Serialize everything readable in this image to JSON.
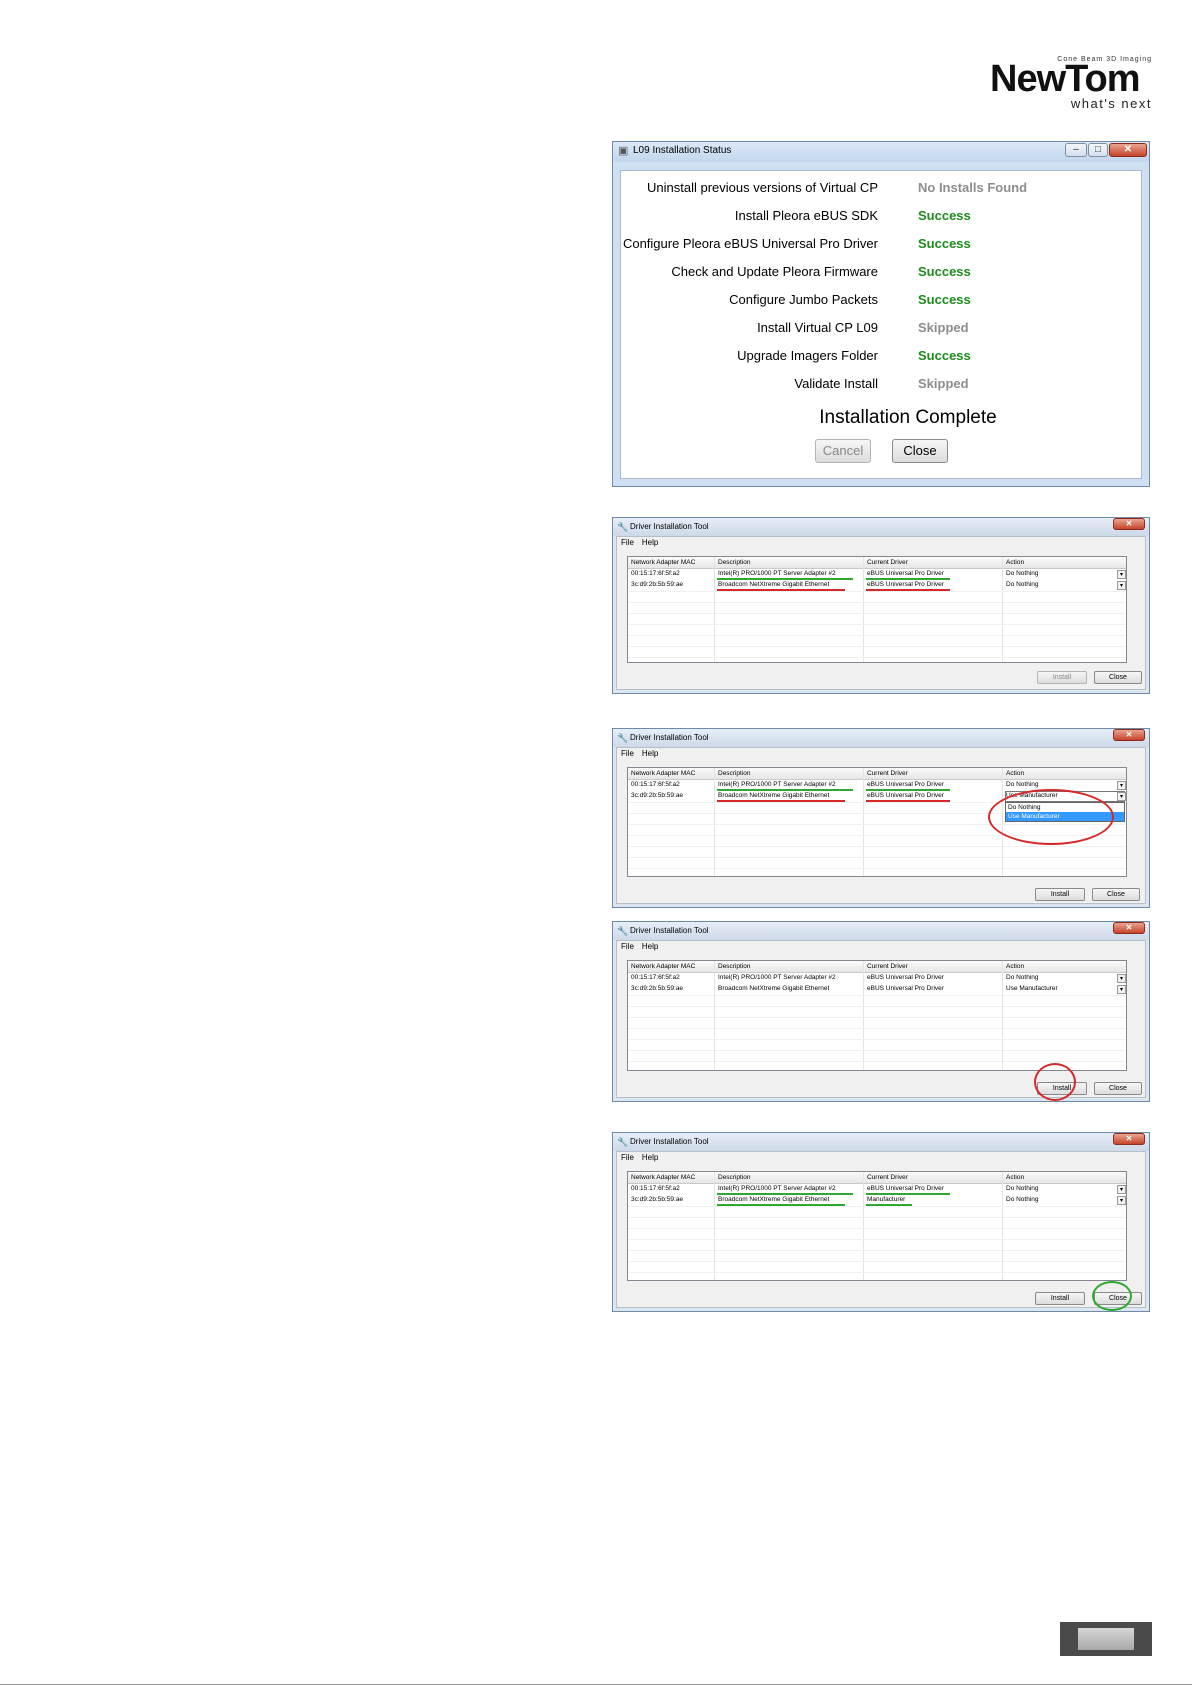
{
  "logo": {
    "tagline_top": "Cone Beam 3D Imaging",
    "brand": "NewTom",
    "tagline_bottom": "what's next"
  },
  "status_window": {
    "title": "L09 Installation Status",
    "steps": [
      {
        "name": "Uninstall previous versions of Virtual CP",
        "status": "No Installs Found",
        "kind": "muted"
      },
      {
        "name": "Install Pleora eBUS SDK",
        "status": "Success",
        "kind": "success"
      },
      {
        "name": "Configure Pleora eBUS Universal Pro Driver",
        "status": "Success",
        "kind": "success"
      },
      {
        "name": "Check and Update Pleora Firmware",
        "status": "Success",
        "kind": "success"
      },
      {
        "name": "Configure Jumbo Packets",
        "status": "Success",
        "kind": "success"
      },
      {
        "name": "Install Virtual CP L09",
        "status": "Skipped",
        "kind": "muted"
      },
      {
        "name": "Upgrade Imagers Folder",
        "status": "Success",
        "kind": "success"
      },
      {
        "name": "Validate Install",
        "status": "Skipped",
        "kind": "muted"
      }
    ],
    "complete_text": "Installation Complete",
    "cancel_label": "Cancel",
    "close_label": "Close"
  },
  "driver_tool": {
    "title": "Driver Installation Tool",
    "menu": [
      "File",
      "Help"
    ],
    "columns": [
      "Network Adapter MAC",
      "Description",
      "Current Driver",
      "Action"
    ],
    "install_label": "Install",
    "close_label": "Close",
    "dropdown_options": [
      "Do Nothing",
      "Use Manufacturer"
    ]
  },
  "screens": [
    {
      "rows": [
        {
          "mac": "00:15:17:6f:5f:a2",
          "desc": "Intel(R) PRO/1000 PT Server Adapter #2",
          "driver": "eBUS Universal Pro Driver",
          "action": "Do Nothing"
        },
        {
          "mac": "3c:d9:2b:5b:59:ae",
          "desc": "Broadcom NetXtreme Gigabit Ethernet",
          "driver": "eBUS Universal Pro Driver",
          "action": "Do Nothing"
        }
      ]
    },
    {
      "rows": [
        {
          "mac": "00:15:17:6f:5f:a2",
          "desc": "Intel(R) PRO/1000 PT Server Adapter #2",
          "driver": "eBUS Universal Pro Driver",
          "action": "Do Nothing"
        },
        {
          "mac": "3c:d9:2b:5b:59:ae",
          "desc": "Broadcom NetXtreme Gigabit Ethernet",
          "driver": "eBUS Universal Pro Driver",
          "action": "Use Manufacturer"
        }
      ]
    },
    {
      "rows": [
        {
          "mac": "00:15:17:6f:5f:a2",
          "desc": "Intel(R) PRO/1000 PT Server Adapter #2",
          "driver": "eBUS Universal Pro Driver",
          "action": "Do Nothing"
        },
        {
          "mac": "3c:d9:2b:5b:59:ae",
          "desc": "Broadcom NetXtreme Gigabit Ethernet",
          "driver": "eBUS Universal Pro Driver",
          "action": "Use Manufacturer"
        }
      ]
    },
    {
      "rows": [
        {
          "mac": "00:15:17:6f:5f:a2",
          "desc": "Intel(R) PRO/1000 PT Server Adapter #2",
          "driver": "eBUS Universal Pro Driver",
          "action": "Do Nothing"
        },
        {
          "mac": "3c:d9:2b:5b:59:ae",
          "desc": "Broadcom NetXtreme Gigabit Ethernet",
          "driver": "Manufacturer",
          "action": "Do Nothing"
        }
      ]
    }
  ],
  "colors": {
    "success": "#1e8c1e",
    "muted": "#8d8d8d",
    "highlight_red": "#d62828",
    "highlight_green": "#2ea82e"
  }
}
